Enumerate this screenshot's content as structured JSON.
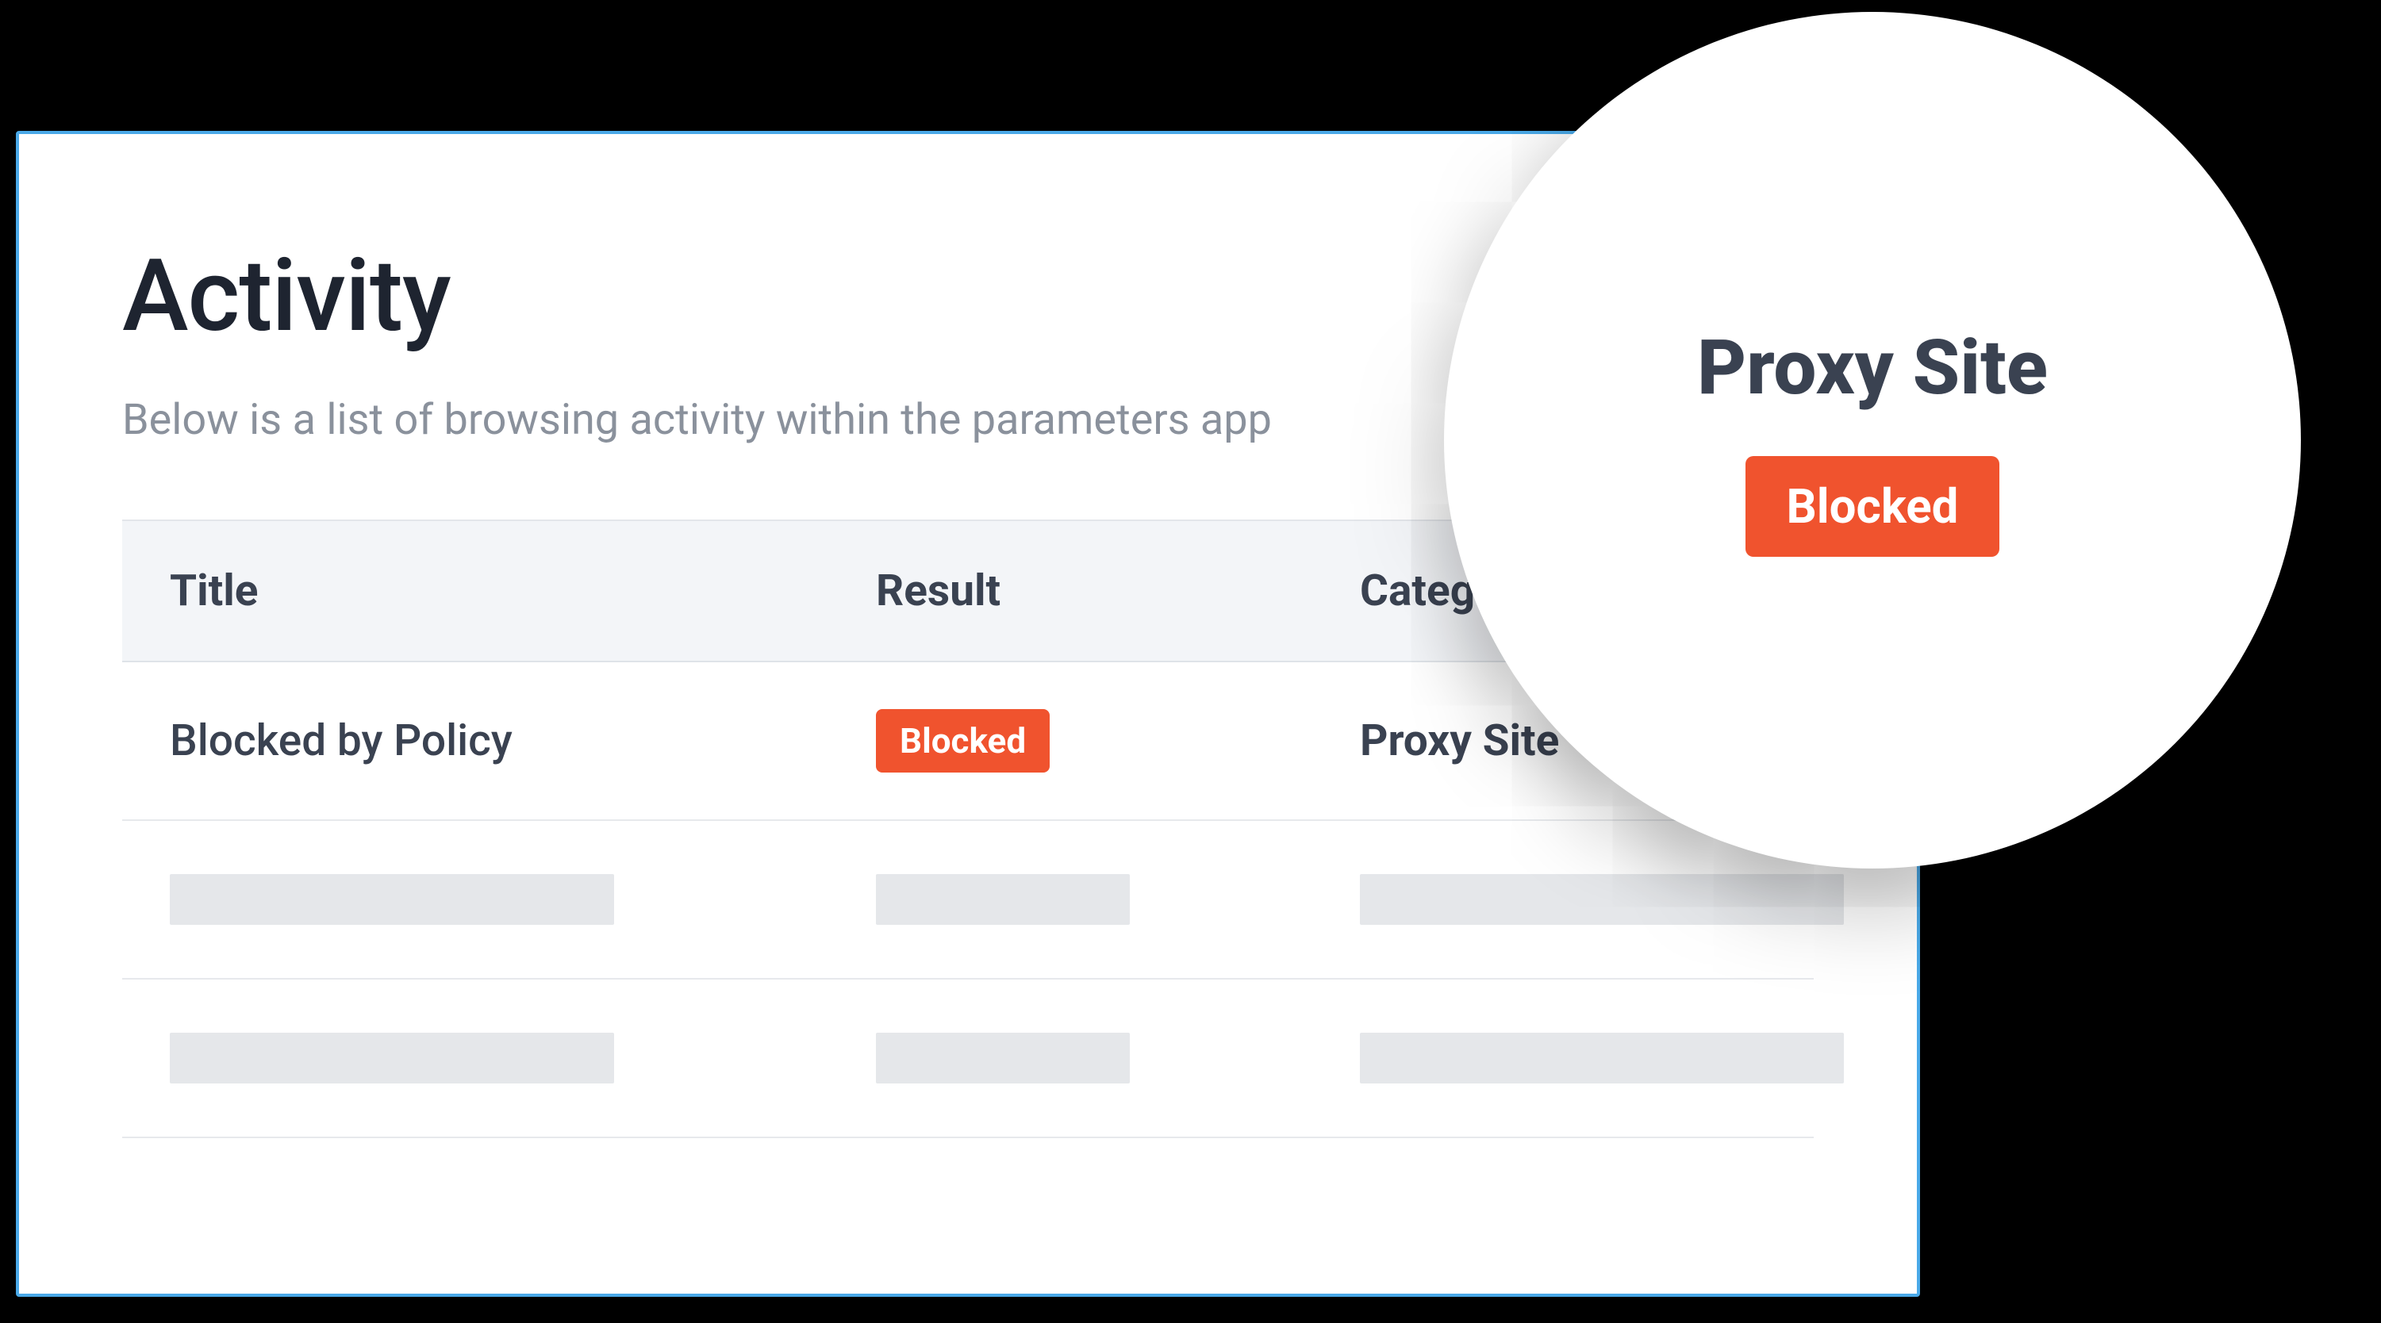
{
  "page": {
    "title": "Activity",
    "subtitle": "Below is a list of browsing activity within the parameters app"
  },
  "table": {
    "headers": {
      "title": "Title",
      "result": "Result",
      "category": "Category"
    },
    "rows": [
      {
        "title": "Blocked by Policy",
        "result_badge": "Blocked",
        "category": "Proxy Site"
      }
    ]
  },
  "lens": {
    "title": "Proxy Site",
    "badge": "Blocked"
  },
  "colors": {
    "accent_red": "#f0532e",
    "panel_border": "#4aa9e8",
    "text_dark": "#3a4251",
    "text_muted": "#8a919c",
    "header_bg": "#f3f5f8",
    "skeleton": "#e5e7ea"
  }
}
